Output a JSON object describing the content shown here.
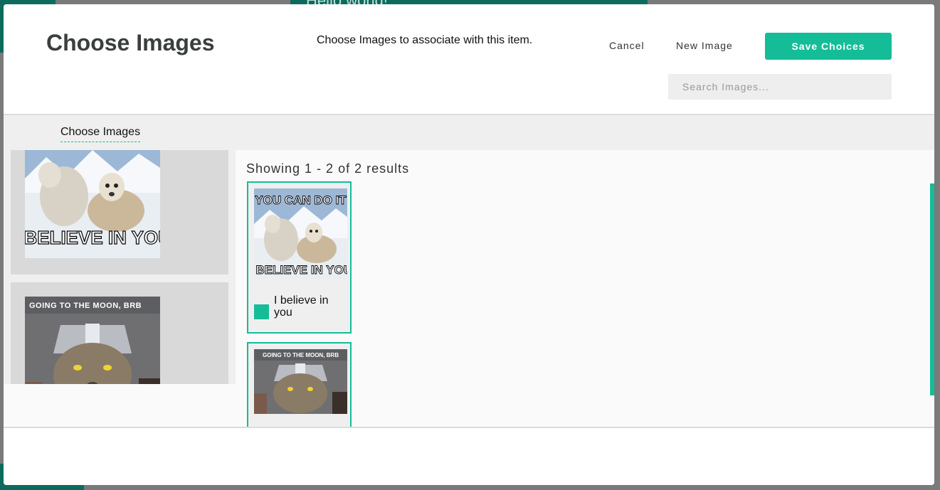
{
  "background": {
    "hello_text": "Hello world!"
  },
  "modal": {
    "title": "Choose Images",
    "description": "Choose Images to associate with this item.",
    "cancel_label": "Cancel",
    "new_image_label": "New Image",
    "save_label": "Save Choices",
    "search": {
      "placeholder": "Search Images...",
      "value": ""
    }
  },
  "tabs": [
    {
      "label": "Choose Images",
      "active": true
    }
  ],
  "preview": [
    {
      "image_icon": "wolf-meme-image",
      "caption_top": "YOU CAN DO IT",
      "caption_bottom": "I BELIEVE IN YOU"
    },
    {
      "image_icon": "cat-meme-image",
      "caption_top": "GOING TO THE MOON, BRB"
    }
  ],
  "results": {
    "count_text": "Showing 1 - 2 of 2 results",
    "items": [
      {
        "title": "I believe in you",
        "meme_top": "YOU CAN DO IT",
        "meme_bottom": "I BELIEVE IN YOU",
        "selected": true
      },
      {
        "title": "",
        "meme_top": "GOING TO THE MOON, BRB",
        "selected": true
      }
    ]
  },
  "colors": {
    "accent": "#14bd98",
    "background_app": "#0c6b5c",
    "tab_bar": "#efefef"
  }
}
